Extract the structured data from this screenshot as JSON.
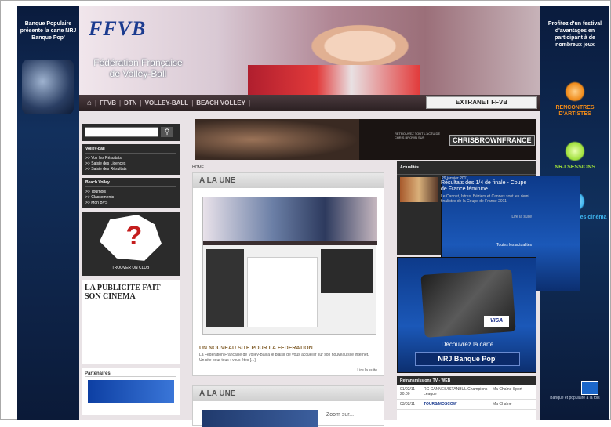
{
  "left_skin": {
    "text": "Banque Populaire présente la carte NRJ Banque Pop'"
  },
  "right_skin": {
    "text": "Profitez d'un festival d'avantages en participant à de nombreux jeux",
    "items": [
      {
        "label": "RENCONTRES D'ARTISTES",
        "color": "#f08a18"
      },
      {
        "label": "NRJ SESSIONS",
        "color": "#9fe03a"
      },
      {
        "label": "Avant-premières cinéma",
        "color": "#3fb6f0"
      }
    ],
    "footer": "Banque et populaire à la fois"
  },
  "header": {
    "logo": "FFVB",
    "subtitle": "Fédération Française de Volley-Ball"
  },
  "nav": {
    "items": [
      "FFVB",
      "DTN",
      "VOLLEY-BALL",
      "BEACH VOLLEY"
    ],
    "extranet": "EXTRANET FFVB"
  },
  "sidebar": {
    "volley_title": "Volley-ball",
    "volley_links": [
      ">> Voir les Résultats",
      ">> Saisie des Licences",
      ">> Saisie des Résultats"
    ],
    "beach_title": "Beach Volley",
    "beach_links": [
      ">> Tournois",
      ">> Classements",
      ">> Mon BVS"
    ],
    "club_label": "TROUVER UN CLUB",
    "pub_text": "LA PUBLICITE FAIT SON CINEMA",
    "partners_title": "Partenaires"
  },
  "banner": {
    "text": "RETROUVEZ TOUT L'ACTU DE CHRIS BROWN SUR",
    "logo": "CHRISBROWNFRANCE"
  },
  "breadcrumb": "HOME",
  "une": {
    "title": "A LA UNE",
    "article_title": "UN NOUVEAU SITE POUR LA FEDERATION",
    "article_text": "La Fédération Française de Volley-Ball a le plaisir de vous accueillir sur son nouveau site internet. Un site pour tous : vous êtes [...]",
    "more": "Lire la suite"
  },
  "une2": {
    "title": "A LA UNE",
    "zoom": "Zoom sur..."
  },
  "actualites": {
    "title": "Actualités",
    "date": "29 janvier 2011",
    "headline": "Résultats des 1/4 de finale - Coupe de France féminine",
    "text": "Le Cannet, Istres, Béziers et Cannes sont les demi finalistes de la Coupe de France 2011",
    "more": "Lire la suite",
    "all": "Toutes les actualités"
  },
  "ad": {
    "text": "Découvrez la carte",
    "button": "NRJ Banque Pop'",
    "visa": "VISA"
  },
  "tv": {
    "title": "Retransmissions TV - WEB",
    "rows": [
      {
        "date": "01/02/11 20:00",
        "match": "RC CANNES/ISTANBUL Champions League",
        "channel": "Ma Chaîne Sport"
      },
      {
        "date": "03/02/11",
        "match": "TOURS/MOSCOW",
        "channel": "Ma Chaîne"
      }
    ]
  }
}
